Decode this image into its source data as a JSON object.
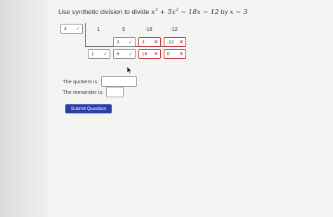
{
  "question": {
    "prefix": "Use synthetic division to divide ",
    "poly_parts": [
      "x",
      "3",
      " + 5x",
      "2",
      " − 18x − 12"
    ],
    "by": " by ",
    "divisor": "x − 3"
  },
  "division": {
    "root_value": "3",
    "coefficients": [
      "1",
      "5",
      "-18",
      "-12"
    ],
    "middle_row": [
      {
        "value": "3",
        "status": "correct"
      },
      {
        "value": "3",
        "status": "incorrect"
      },
      {
        "value": "-12",
        "status": "incorrect"
      }
    ],
    "bottom_row": [
      {
        "value": "1",
        "status": "correct"
      },
      {
        "value": "8",
        "status": "correct"
      },
      {
        "value": "15",
        "status": "incorrect"
      },
      {
        "value": "0",
        "status": "incorrect"
      }
    ]
  },
  "answers": {
    "quotient_label": "The quotient is:",
    "quotient_value": "",
    "remainder_label": "The remainder is:",
    "remainder_value": ""
  },
  "submit_label": "Submit Question",
  "icons": {
    "correct": "check-icon",
    "incorrect": "cross-icon"
  },
  "colors": {
    "check": "#3c8a3c",
    "cross": "#c0392b",
    "button": "#2c3ea8"
  }
}
